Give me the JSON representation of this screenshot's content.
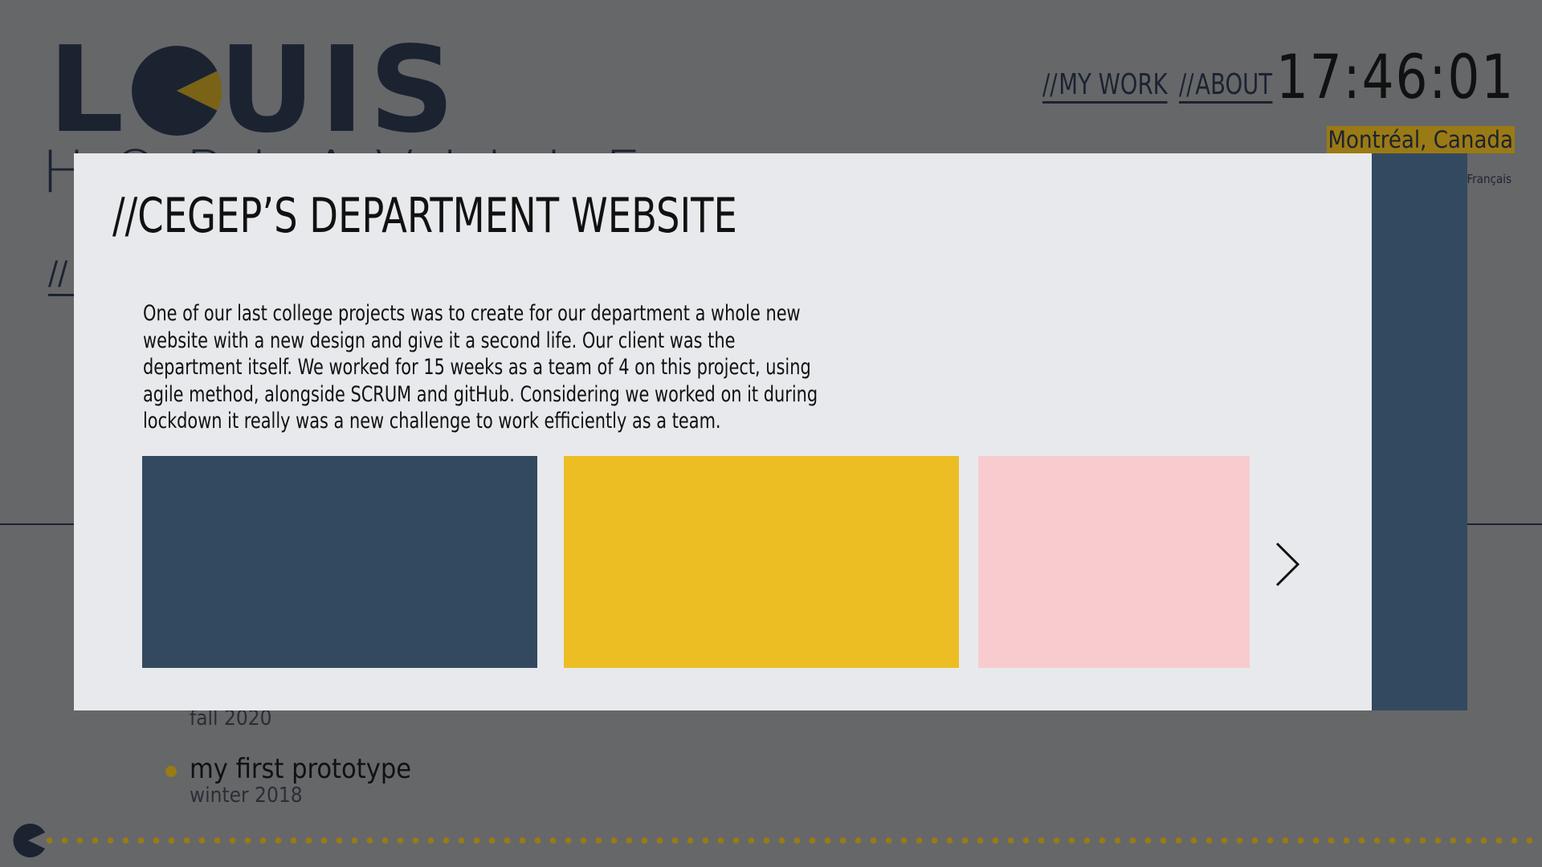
{
  "logo": {
    "line1": "LOUIS",
    "line2": "HOBLAVILLE"
  },
  "nav": {
    "items": [
      {
        "slashes": "//",
        "label": "MY WORK"
      },
      {
        "slashes": "//",
        "label": "ABOUT"
      }
    ]
  },
  "clock": {
    "time": "17:46:01",
    "location": "Montréal, Canada"
  },
  "language": {
    "label": "Français"
  },
  "background": {
    "heading_fragment": "//",
    "projects": [
      {
        "title": "",
        "date": "fall 2020"
      },
      {
        "title": "my first prototype",
        "date": "winter 2018"
      }
    ]
  },
  "modal": {
    "title": "//CEGEP’S DEPARTMENT WEBSITE",
    "description": "One of our last college projects was to create for our department a whole new website with a new design and give it a second life. Our client was the department itself. We worked for 15 weeks as a team of 4 on this project, using agile method, alongside SCRUM and gitHub. Considering we worked on it during lockdown it really was a new challenge to work efficiently as a team.",
    "slides": [
      {
        "color": "#33495f"
      },
      {
        "color": "#ecbe24"
      },
      {
        "color": "#f8cccf"
      }
    ],
    "next_icon": "chevron-right-icon"
  },
  "colors": {
    "background": "#666769",
    "navy": "#1b2331",
    "accent_gold": "#9a7a14",
    "modal_bg": "#e8e9ec",
    "modal_side": "#33495f"
  }
}
